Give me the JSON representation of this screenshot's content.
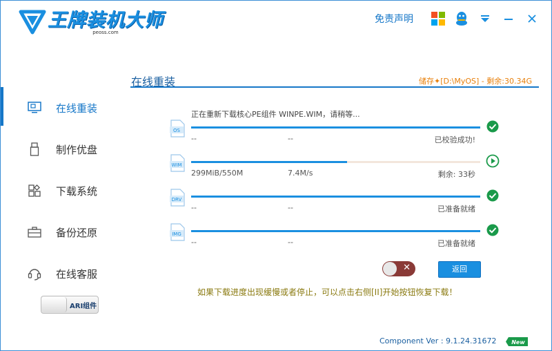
{
  "header": {
    "app_title": "王牌装机大师",
    "app_sub": "peoss.com",
    "disclaimer": "免责声明",
    "icons": [
      "windows-icon",
      "qq-icon",
      "menu-icon",
      "minimize-icon",
      "close-icon"
    ]
  },
  "sidebar": {
    "items": [
      {
        "label": "在线重装",
        "icon": "monitor-icon",
        "active": true
      },
      {
        "label": "制作优盘",
        "icon": "usb-icon",
        "active": false
      },
      {
        "label": "下载系统",
        "icon": "grid-icon",
        "active": false
      },
      {
        "label": "备份还原",
        "icon": "briefcase-icon",
        "active": false
      },
      {
        "label": "在线客服",
        "icon": "headset-icon",
        "active": false
      }
    ],
    "ari_label": "ARI组件"
  },
  "main": {
    "title": "在线重装",
    "storage": "储存✦[D:\\MyOS] - 剩余:30.34G",
    "status_message": "正在重新下载核心PE组件 WINPE.WIM，请稍等...",
    "rows": [
      {
        "icon_label": "OS",
        "progress": 1.0,
        "c1": "--",
        "c2": "--",
        "c3": "已校验成功!",
        "status": "check"
      },
      {
        "icon_label": "WIM",
        "progress": 0.54,
        "c1": "299MiB/550M",
        "c2": "7.4M/s",
        "c3": "剩余: 33秒",
        "status": "play"
      },
      {
        "icon_label": "DRV",
        "progress": 1.0,
        "c1": "--",
        "c2": "--",
        "c3": "已准备就绪",
        "status": "check"
      },
      {
        "icon_label": "IMG",
        "progress": 1.0,
        "c1": "--",
        "c2": "--",
        "c3": "已准备就绪",
        "status": "check"
      }
    ],
    "back_label": "返回",
    "hint": "如果下载进度出现缓慢或者停止，可以点击右侧[II]开始按钮恢复下载！",
    "version": "Component Ver : 9.1.24.31672",
    "new_badge": "New"
  },
  "colors": {
    "accent": "#1a8fe0",
    "success": "#1a9a4a",
    "warning_text": "#e8800c"
  }
}
